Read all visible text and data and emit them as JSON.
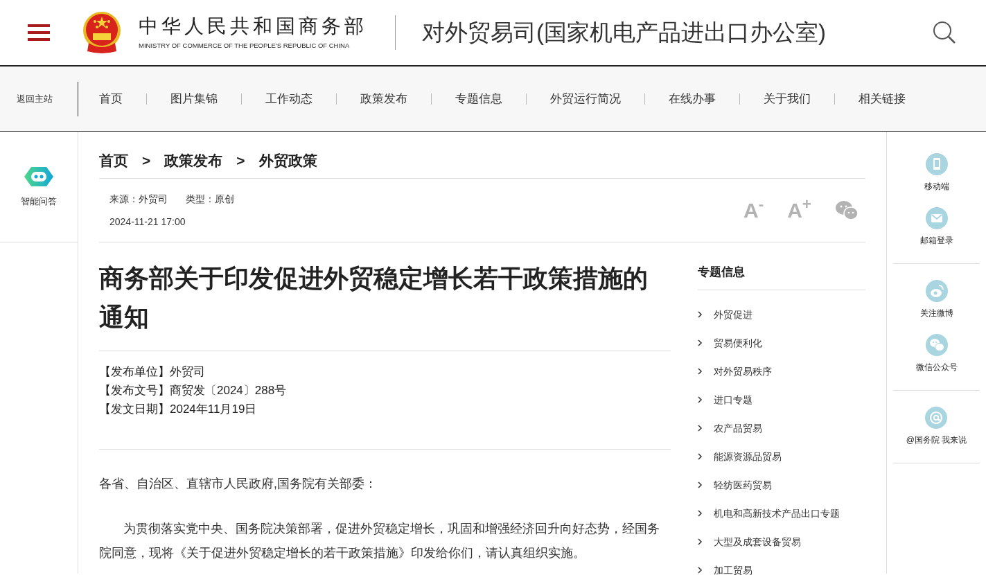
{
  "header": {
    "org_name": "中华人民共和国商务部",
    "org_name_en": "MINISTRY OF COMMERCE OF THE PEOPLE'S REPUBLIC OF CHINA",
    "site_title": "对外贸易司(国家机电产品进出口办公室)"
  },
  "nav": {
    "back_link": "返回主站",
    "items": [
      {
        "label": "首页"
      },
      {
        "label": "图片集锦"
      },
      {
        "label": "工作动态"
      },
      {
        "label": "政策发布"
      },
      {
        "label": "专题信息"
      },
      {
        "label": "外贸运行简况"
      },
      {
        "label": "在线办事"
      },
      {
        "label": "关于我们"
      },
      {
        "label": "相关链接"
      }
    ]
  },
  "left_rail": {
    "assistant_label": "智能问答"
  },
  "breadcrumb": {
    "separator": ">",
    "items": [
      "首页",
      "政策发布",
      "外贸政策"
    ]
  },
  "meta": {
    "source": "来源：外贸司",
    "type": "类型：原创",
    "date": "2024-11-21 17:00"
  },
  "font_controls": [
    "A$^{-}$",
    "A$^{+}$"
  ],
  "article": {
    "title": "商务部关于印发促进外贸稳定增长若干政策措施的通知",
    "info": [
      "【发布单位】外贸司",
      "【发布文号】商贸发〔2024〕288号",
      "【发文日期】2024年11月19日"
    ],
    "paragraphs": [
      {
        "kind": "salutation",
        "text": "各省、自治区、直辖市人民政府,国务院有关部委："
      },
      {
        "kind": "body",
        "text": "为贯彻落实党中央、国务院决策部署，促进外贸稳定增长，巩固和增强经济回升向好态势，经国务院同意，现将《关于促进外贸稳定增长的若干政策措施》印发给你们，请认真组织实施。"
      }
    ]
  },
  "topics": {
    "title": "专题信息",
    "items": [
      "外贸促进",
      "贸易便利化",
      "对外贸易秩序",
      "进口专题",
      "农产品贸易",
      "能源资源品贸易",
      "轻纺医药贸易",
      "机电和高新技术产品出口专题",
      "大型及成套设备贸易",
      "加工贸易"
    ]
  },
  "right_rail": {
    "groups": [
      [
        {
          "kind": "mobile",
          "label": "移动端"
        },
        {
          "kind": "mail",
          "label": "邮箱登录"
        }
      ],
      [
        {
          "kind": "weibo",
          "label": "关注微博"
        },
        {
          "kind": "wechat",
          "label": "微信公众号"
        }
      ],
      [
        {
          "kind": "at",
          "label": "@国务院 我来说"
        }
      ]
    ]
  }
}
